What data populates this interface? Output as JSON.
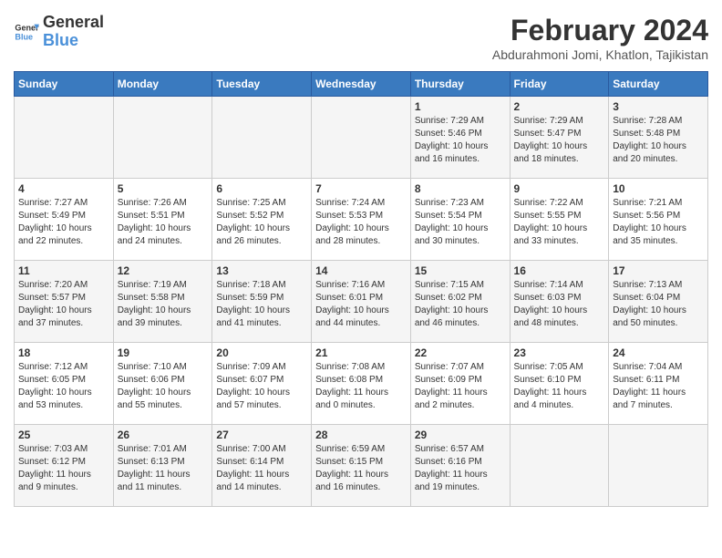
{
  "header": {
    "logo_line1": "General",
    "logo_line2": "Blue",
    "month_title": "February 2024",
    "subtitle": "Abdurahmoni Jomi, Khatlon, Tajikistan"
  },
  "days_of_week": [
    "Sunday",
    "Monday",
    "Tuesday",
    "Wednesday",
    "Thursday",
    "Friday",
    "Saturday"
  ],
  "weeks": [
    [
      {
        "day": "",
        "info": ""
      },
      {
        "day": "",
        "info": ""
      },
      {
        "day": "",
        "info": ""
      },
      {
        "day": "",
        "info": ""
      },
      {
        "day": "1",
        "info": "Sunrise: 7:29 AM\nSunset: 5:46 PM\nDaylight: 10 hours\nand 16 minutes."
      },
      {
        "day": "2",
        "info": "Sunrise: 7:29 AM\nSunset: 5:47 PM\nDaylight: 10 hours\nand 18 minutes."
      },
      {
        "day": "3",
        "info": "Sunrise: 7:28 AM\nSunset: 5:48 PM\nDaylight: 10 hours\nand 20 minutes."
      }
    ],
    [
      {
        "day": "4",
        "info": "Sunrise: 7:27 AM\nSunset: 5:49 PM\nDaylight: 10 hours\nand 22 minutes."
      },
      {
        "day": "5",
        "info": "Sunrise: 7:26 AM\nSunset: 5:51 PM\nDaylight: 10 hours\nand 24 minutes."
      },
      {
        "day": "6",
        "info": "Sunrise: 7:25 AM\nSunset: 5:52 PM\nDaylight: 10 hours\nand 26 minutes."
      },
      {
        "day": "7",
        "info": "Sunrise: 7:24 AM\nSunset: 5:53 PM\nDaylight: 10 hours\nand 28 minutes."
      },
      {
        "day": "8",
        "info": "Sunrise: 7:23 AM\nSunset: 5:54 PM\nDaylight: 10 hours\nand 30 minutes."
      },
      {
        "day": "9",
        "info": "Sunrise: 7:22 AM\nSunset: 5:55 PM\nDaylight: 10 hours\nand 33 minutes."
      },
      {
        "day": "10",
        "info": "Sunrise: 7:21 AM\nSunset: 5:56 PM\nDaylight: 10 hours\nand 35 minutes."
      }
    ],
    [
      {
        "day": "11",
        "info": "Sunrise: 7:20 AM\nSunset: 5:57 PM\nDaylight: 10 hours\nand 37 minutes."
      },
      {
        "day": "12",
        "info": "Sunrise: 7:19 AM\nSunset: 5:58 PM\nDaylight: 10 hours\nand 39 minutes."
      },
      {
        "day": "13",
        "info": "Sunrise: 7:18 AM\nSunset: 5:59 PM\nDaylight: 10 hours\nand 41 minutes."
      },
      {
        "day": "14",
        "info": "Sunrise: 7:16 AM\nSunset: 6:01 PM\nDaylight: 10 hours\nand 44 minutes."
      },
      {
        "day": "15",
        "info": "Sunrise: 7:15 AM\nSunset: 6:02 PM\nDaylight: 10 hours\nand 46 minutes."
      },
      {
        "day": "16",
        "info": "Sunrise: 7:14 AM\nSunset: 6:03 PM\nDaylight: 10 hours\nand 48 minutes."
      },
      {
        "day": "17",
        "info": "Sunrise: 7:13 AM\nSunset: 6:04 PM\nDaylight: 10 hours\nand 50 minutes."
      }
    ],
    [
      {
        "day": "18",
        "info": "Sunrise: 7:12 AM\nSunset: 6:05 PM\nDaylight: 10 hours\nand 53 minutes."
      },
      {
        "day": "19",
        "info": "Sunrise: 7:10 AM\nSunset: 6:06 PM\nDaylight: 10 hours\nand 55 minutes."
      },
      {
        "day": "20",
        "info": "Sunrise: 7:09 AM\nSunset: 6:07 PM\nDaylight: 10 hours\nand 57 minutes."
      },
      {
        "day": "21",
        "info": "Sunrise: 7:08 AM\nSunset: 6:08 PM\nDaylight: 11 hours\nand 0 minutes."
      },
      {
        "day": "22",
        "info": "Sunrise: 7:07 AM\nSunset: 6:09 PM\nDaylight: 11 hours\nand 2 minutes."
      },
      {
        "day": "23",
        "info": "Sunrise: 7:05 AM\nSunset: 6:10 PM\nDaylight: 11 hours\nand 4 minutes."
      },
      {
        "day": "24",
        "info": "Sunrise: 7:04 AM\nSunset: 6:11 PM\nDaylight: 11 hours\nand 7 minutes."
      }
    ],
    [
      {
        "day": "25",
        "info": "Sunrise: 7:03 AM\nSunset: 6:12 PM\nDaylight: 11 hours\nand 9 minutes."
      },
      {
        "day": "26",
        "info": "Sunrise: 7:01 AM\nSunset: 6:13 PM\nDaylight: 11 hours\nand 11 minutes."
      },
      {
        "day": "27",
        "info": "Sunrise: 7:00 AM\nSunset: 6:14 PM\nDaylight: 11 hours\nand 14 minutes."
      },
      {
        "day": "28",
        "info": "Sunrise: 6:59 AM\nSunset: 6:15 PM\nDaylight: 11 hours\nand 16 minutes."
      },
      {
        "day": "29",
        "info": "Sunrise: 6:57 AM\nSunset: 6:16 PM\nDaylight: 11 hours\nand 19 minutes."
      },
      {
        "day": "",
        "info": ""
      },
      {
        "day": "",
        "info": ""
      }
    ]
  ]
}
